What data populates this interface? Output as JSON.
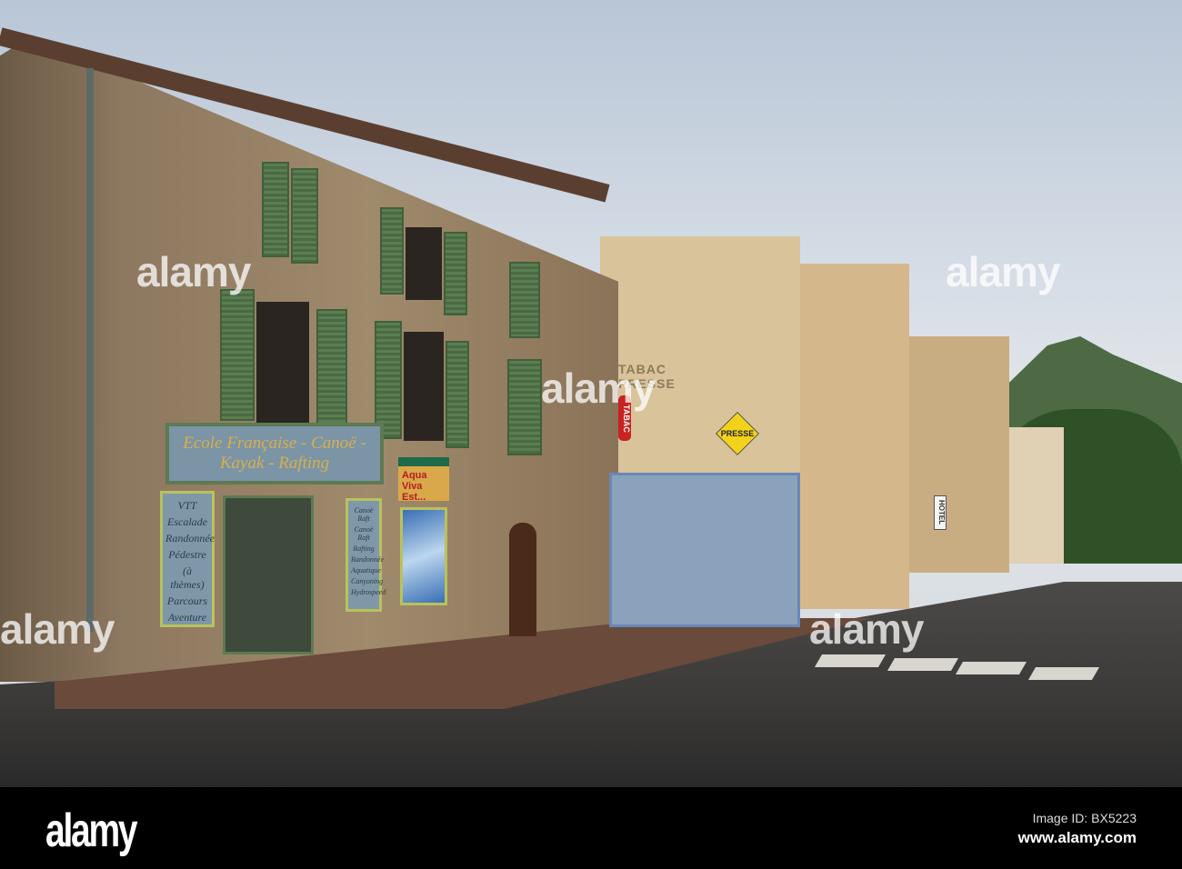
{
  "signs": {
    "ecole": "Ecole Française - Canoë - Kayak - Rafting",
    "panel_left": [
      "VTT",
      "Escalade",
      "Randonnée",
      "Pédestre",
      "(à thèmes)",
      "Parcours",
      "Aventure"
    ],
    "panel_right": [
      "Canoë Raft",
      "Canoë Raft",
      "Rafting",
      "Randonnée",
      "Aquatique",
      "Canyoning",
      "Hydrospeed"
    ],
    "aqua": "Aqua Viva Est...",
    "tabac_presse": "TABAC PRESSE",
    "tabac": "TABAC",
    "presse": "PRESSE",
    "hotel": "HOTEL"
  },
  "watermark": "alamy",
  "footer": {
    "logo": "alamy",
    "image_id": "Image ID: BX5223",
    "url": "www.alamy.com"
  }
}
